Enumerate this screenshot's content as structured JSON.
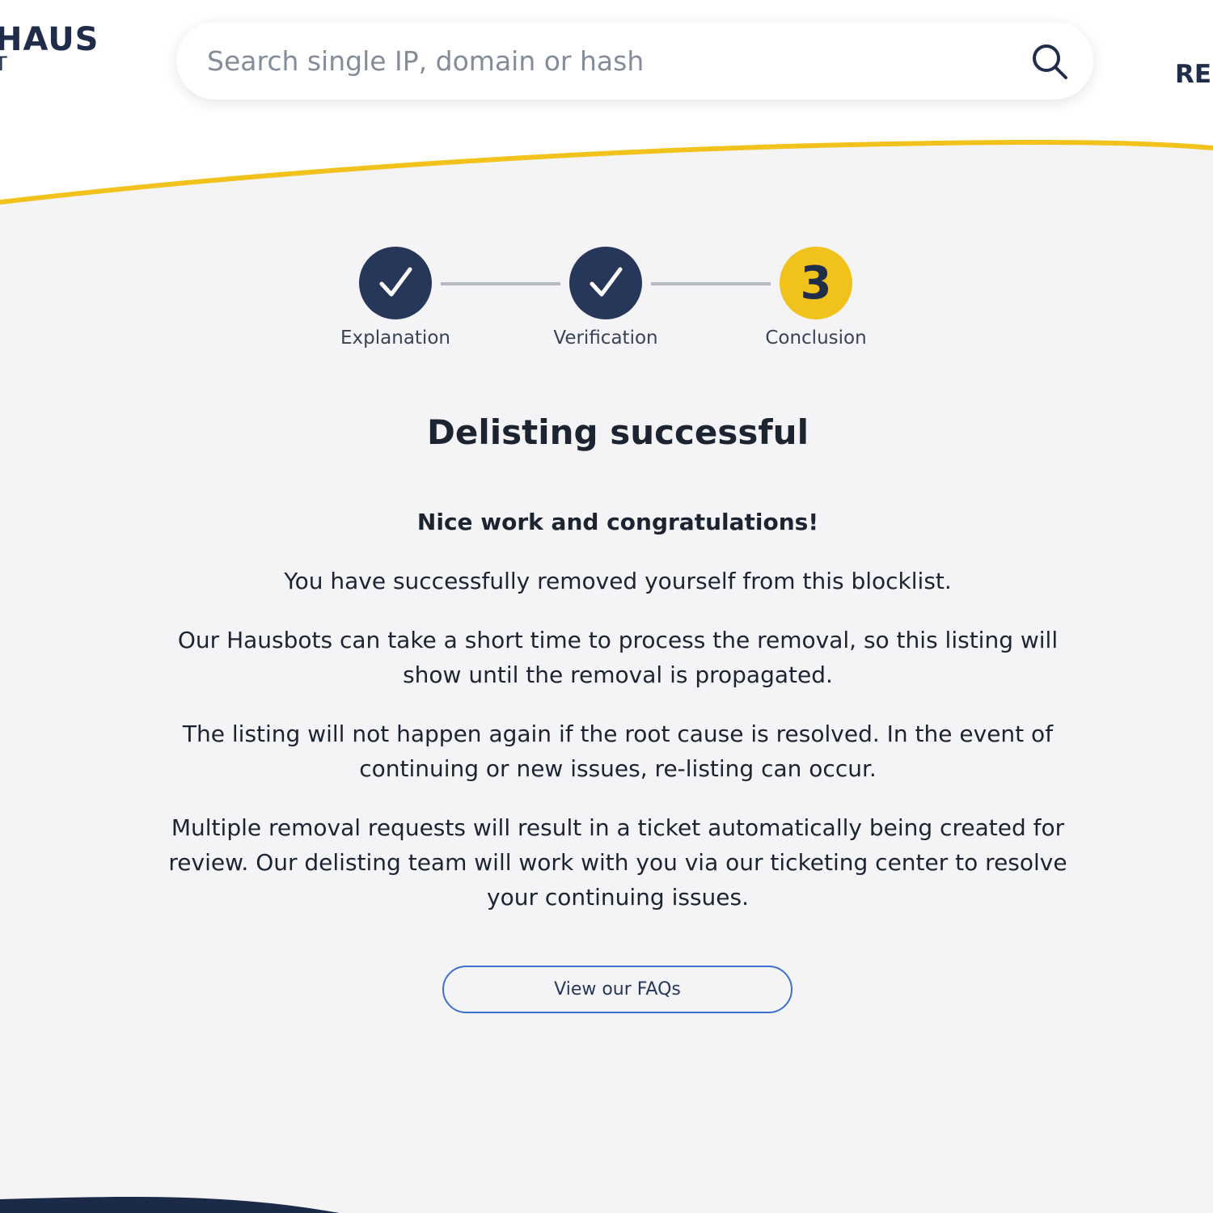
{
  "colors": {
    "navy": "#27375a",
    "accent_yellow": "#f1c21b",
    "body_bg": "#f4f4f7",
    "button_border": "#3c6fd1"
  },
  "header": {
    "logo_main": "HAUS",
    "logo_sub": "T",
    "search": {
      "placeholder": "Search single IP, domain or hash",
      "value": "",
      "icon": "search-icon"
    },
    "nav_partial_label": "RE"
  },
  "stepper": {
    "steps": [
      {
        "label": "Explanation",
        "state": "complete",
        "icon": "checkmark-icon"
      },
      {
        "label": "Verification",
        "state": "complete",
        "icon": "checkmark-icon"
      },
      {
        "label": "Conclusion",
        "state": "current",
        "number": "3"
      }
    ]
  },
  "main": {
    "title": "Delisting successful",
    "lead": "Nice work and congratulations!",
    "paragraphs": [
      "You have successfully removed yourself from this blocklist.",
      "Our Hausbots can take a short time to process the removal, so this listing will show until the removal is propagated.",
      "The listing will not happen again if the root cause is resolved. In the event of continuing or new issues, re-listing can occur.",
      "Multiple removal requests will result in a ticket automatically being created for review. Our delisting team will work with you via our ticketing center to resolve your continuing issues."
    ],
    "faq_button_label": "View our FAQs"
  }
}
